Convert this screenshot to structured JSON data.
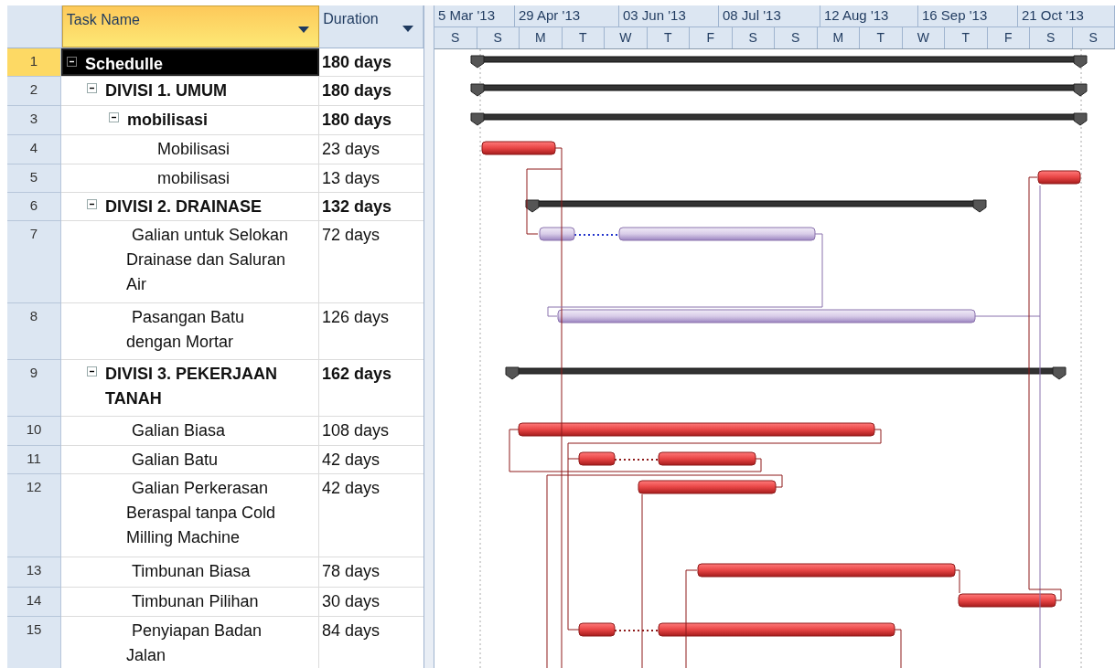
{
  "columns": [
    {
      "label": "Task Name",
      "selected": true
    },
    {
      "label": "Duration",
      "selected": false
    }
  ],
  "timescale": {
    "major": [
      "5 Mar '13",
      "29 Apr '13",
      "03 Jun '13",
      "08 Jul '13",
      "12 Aug '13",
      "16 Sep '13",
      "21 Oct '13"
    ],
    "minor": [
      "S",
      "S",
      "M",
      "T",
      "W",
      "T",
      "F",
      "S",
      "S",
      "M",
      "T",
      "W",
      "T",
      "F",
      "S",
      "S"
    ]
  },
  "tasks": [
    {
      "id": "1",
      "name": "Schedulle",
      "duration": "180 days",
      "kind": "summary",
      "expanded": true,
      "selected": true,
      "children": [
        {
          "id": "2",
          "name": "DIVISI 1. UMUM",
          "duration": "180 days",
          "kind": "summary",
          "expanded": true,
          "selected": false,
          "children": [
            {
              "id": "3",
              "name": "mobilisasi",
              "duration": "180 days",
              "kind": "summary",
              "expanded": true,
              "selected": false,
              "children": [
                {
                  "id": "4",
                  "name": "Mobilisasi",
                  "duration": "23 days",
                  "kind": "task",
                  "critical": true,
                  "selected": false
                },
                {
                  "id": "5",
                  "name": "mobilisasi",
                  "duration": "13 days",
                  "kind": "task",
                  "critical": true,
                  "selected": false
                }
              ]
            }
          ]
        },
        {
          "id": "6",
          "name": "DIVISI 2. DRAINASE",
          "duration": "132 days",
          "kind": "summary",
          "expanded": true,
          "selected": false,
          "children": [
            {
              "id": "7",
              "name": "Galian untuk Selokan Drainase dan Saluran Air",
              "duration": "72 days",
              "kind": "task",
              "critical": false,
              "selected": false
            },
            {
              "id": "8",
              "name": "Pasangan Batu dengan Mortar",
              "duration": "126 days",
              "kind": "task",
              "critical": false,
              "selected": false
            }
          ]
        },
        {
          "id": "9",
          "name": "DIVISI 3. PEKERJAAN TANAH",
          "duration": "162 days",
          "kind": "summary",
          "expanded": true,
          "selected": false,
          "children": [
            {
              "id": "10",
              "name": "Galian Biasa",
              "duration": "108 days",
              "kind": "task",
              "critical": true,
              "selected": false
            },
            {
              "id": "11",
              "name": "Galian Batu",
              "duration": "42 days",
              "kind": "task",
              "critical": true,
              "selected": false
            },
            {
              "id": "12",
              "name": "Galian Perkerasan Beraspal tanpa Cold Milling Machine",
              "duration": "42 days",
              "kind": "task",
              "critical": true,
              "selected": false
            },
            {
              "id": "13",
              "name": "Timbunan Biasa",
              "duration": "78 days",
              "kind": "task",
              "critical": true,
              "selected": false
            },
            {
              "id": "14",
              "name": "Timbunan Pilihan",
              "duration": "30 days",
              "kind": "task",
              "critical": true,
              "selected": false
            },
            {
              "id": "15",
              "name": "Penyiapan Badan Jalan",
              "duration": "84 days",
              "kind": "task",
              "critical": true,
              "selected": false
            }
          ]
        }
      ]
    }
  ]
}
